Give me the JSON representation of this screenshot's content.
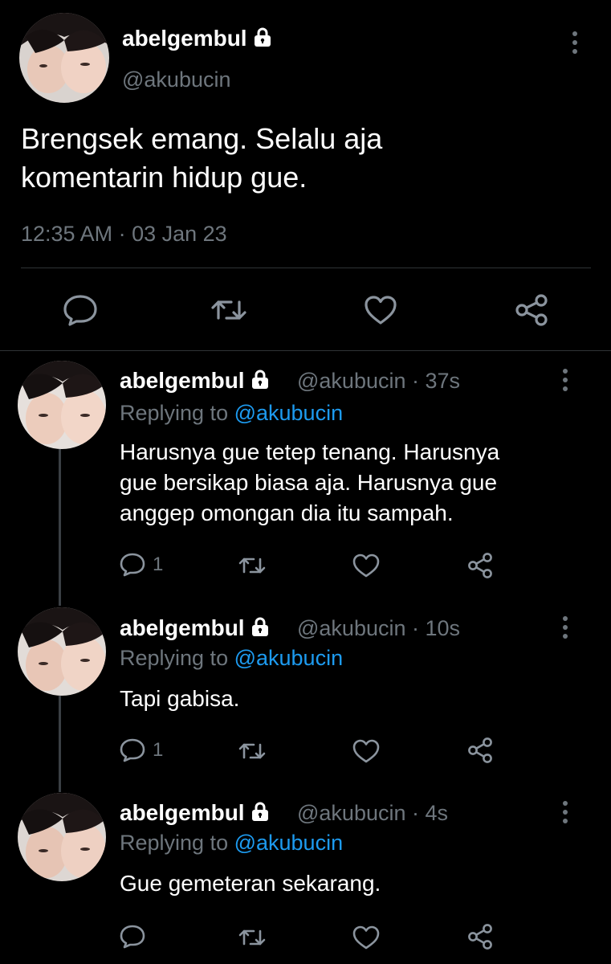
{
  "main_tweet": {
    "display_name": "abelgembul",
    "handle": "@akubucin",
    "text_line1": "Brengsek emang. Selalu aja",
    "text_line2": "komentarin hidup gue.",
    "timestamp": "12:35 AM · 03 Jan 23"
  },
  "replies": [
    {
      "display_name": "abelgembul",
      "handle_time": "@akubucin · 37s",
      "replying_prefix": "Replying to ",
      "replying_handle": "@akubucin",
      "text_lines": [
        "Harusnya gue tetep tenang. Harusnya",
        "gue bersikap biasa aja. Harusnya gue",
        "anggep omongan dia itu sampah."
      ],
      "reply_count": "1"
    },
    {
      "display_name": "abelgembul",
      "handle_time": "@akubucin · 10s",
      "replying_prefix": "Replying to ",
      "replying_handle": "@akubucin",
      "text_lines": [
        "Tapi gabisa."
      ],
      "reply_count": "1"
    },
    {
      "display_name": "abelgembul",
      "handle_time": "@akubucin · 4s",
      "replying_prefix": "Replying to ",
      "replying_handle": "@akubucin",
      "text_lines": [
        "Gue gemeteran sekarang."
      ],
      "reply_count": ""
    }
  ],
  "colors": {
    "background": "#000000",
    "muted": "#6e767d",
    "link": "#1d9bf0",
    "divider": "#2f3336"
  },
  "icons": [
    "lock-icon",
    "more-options-icon",
    "reply-icon",
    "retweet-icon",
    "like-icon",
    "share-icon"
  ]
}
